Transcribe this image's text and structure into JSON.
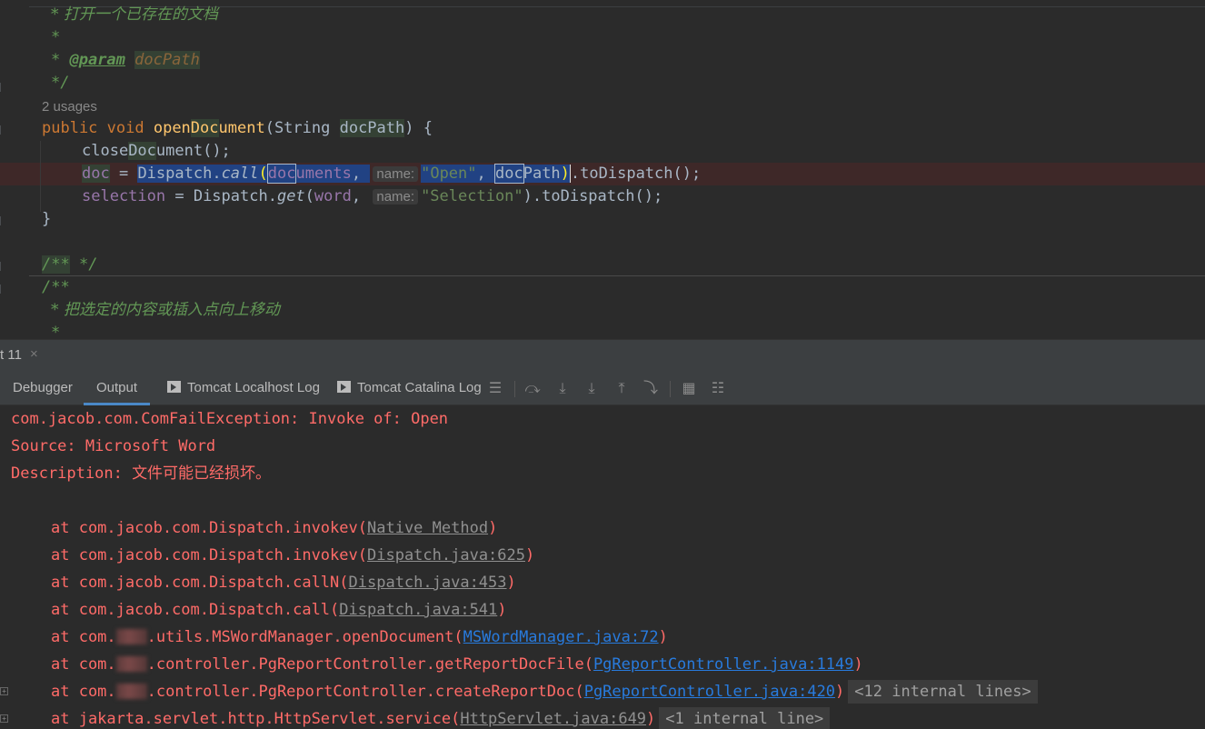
{
  "editor": {
    "lines": {
      "c1": "* 打开一个已存在的文档",
      "c2": "*",
      "c3_star": "* ",
      "c3_tag": "@param",
      "c3_param": "docPath",
      "c4": "*/",
      "usages": "2 usages",
      "sig_public": "public ",
      "sig_void": "void ",
      "sig_name_a": "open",
      "sig_name_b": "Doc",
      "sig_name_c": "ument",
      "sig_paren": "(String ",
      "sig_param": "docPath",
      "sig_end": ") {",
      "l2_a": "close",
      "l2_b": "Doc",
      "l2_c": "ument();",
      "l3_doc": "doc",
      "l3_eq": " = ",
      "l3_call": "Dispatch.",
      "l3_method": "call",
      "l3_open": "(",
      "l3_docs_a": "doc",
      "l3_docs_b": "uments",
      "l3_comma": ", ",
      "hint_name": "name:",
      "l3_str": "\"Open\"",
      "l3_comma2": ", ",
      "l3_p_a": "doc",
      "l3_p_b": "Path",
      "l3_close": ")",
      "l3_tail": ".toDispatch();",
      "l4_sel": "selection",
      "l4_eq": " = Dispatch.",
      "l4_method": "get",
      "l4_open": "(",
      "l4_word": "word",
      "l4_comma": ", ",
      "l4_str": "\"Selection\"",
      "l4_tail": ").toDispatch();",
      "close_brace": "}",
      "empty_doc_a": "/**",
      "empty_doc_b": " */",
      "next_doc": "/**",
      "next_c1": "* 把选定的内容或插入点向上移动",
      "next_c2": "*"
    }
  },
  "toolwindow": {
    "title": "t 11",
    "close": "×",
    "tabs": [
      "Debugger",
      "Output",
      "Tomcat Localhost Log",
      "Tomcat Catalina Log"
    ],
    "active_tab": "Output"
  },
  "console": {
    "l1": "com.jacob.com.ComFailException: Invoke of: Open",
    "l2": "Source: Microsoft Word",
    "l3_label": "Description: ",
    "l3_msg": "文件可能已经损坏。",
    "frames": [
      {
        "pre": "at com.jacob.com.Dispatch.invokev(",
        "link": "Native Method",
        "post": ")"
      },
      {
        "pre": "at com.jacob.com.Dispatch.invokev(",
        "link": "Dispatch.java:625",
        "post": ")"
      },
      {
        "pre": "at com.jacob.com.Dispatch.callN(",
        "link": "Dispatch.java:453",
        "post": ")"
      },
      {
        "pre": "at com.jacob.com.Dispatch.call(",
        "link": "Dispatch.java:541",
        "post": ")"
      }
    ],
    "f5_pre": "at com.",
    "f5_mid": ".utils.MSWordManager.openDocument(",
    "f5_link": "MSWordManager.java:72",
    "f6_pre": "at com.",
    "f6_mid": ".controller.PgReportController.getReportDocFile(",
    "f6_link": "PgReportController.java:1149",
    "f7_pre": "at com.",
    "f7_mid": ".controller.PgReportController.createReportDoc(",
    "f7_link": "PgReportController.java:420",
    "f7_collapsed": "<12 internal lines>",
    "f8_pre": "at jakarta.servlet.http.HttpServlet.service(",
    "f8_link": "HttpServlet.java:649",
    "f8_collapsed": "<1 internal line>",
    "close_paren": ")"
  }
}
